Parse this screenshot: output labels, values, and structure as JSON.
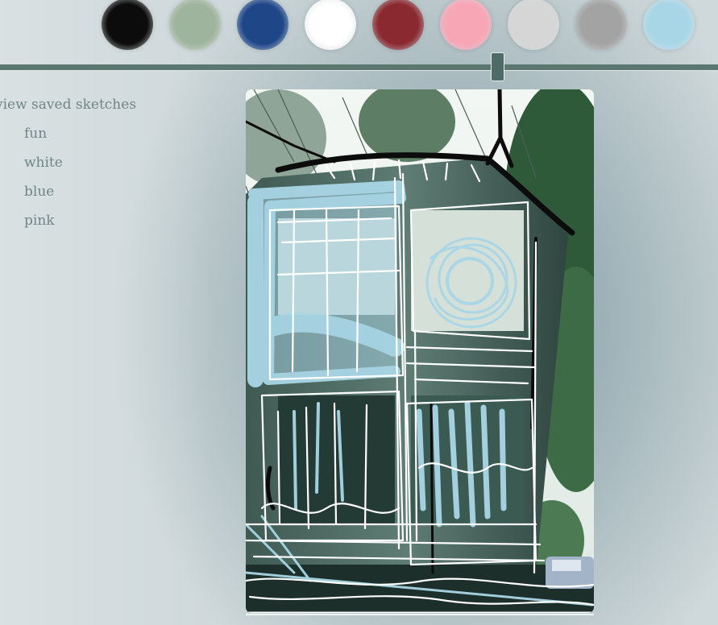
{
  "palette": {
    "swatches": [
      {
        "name": "black",
        "color": "#0c0c0c"
      },
      {
        "name": "sage",
        "color": "#9fb49c"
      },
      {
        "name": "navy",
        "color": "#1f4788"
      },
      {
        "name": "white",
        "color": "#ffffff"
      },
      {
        "name": "maroon",
        "color": "#8a2a30"
      },
      {
        "name": "pink",
        "color": "#f7a6b6"
      },
      {
        "name": "light-gray",
        "color": "#d6d6d6"
      },
      {
        "name": "gray",
        "color": "#a3a3a3"
      },
      {
        "name": "light-blue",
        "color": "#a9d6e6"
      }
    ]
  },
  "brush_size_slider": {
    "track_color": "#5c7670",
    "thumb_color": "#4f6b68"
  },
  "saved_sketches": {
    "title": "view saved sketches",
    "items": [
      "fun",
      "white",
      "blue",
      "pink"
    ]
  },
  "canvas": {
    "background_photo": "victorian-house-in-trees",
    "stroke_colors": [
      "#ffffff",
      "#a9d6e6",
      "#0c0c0c"
    ]
  }
}
